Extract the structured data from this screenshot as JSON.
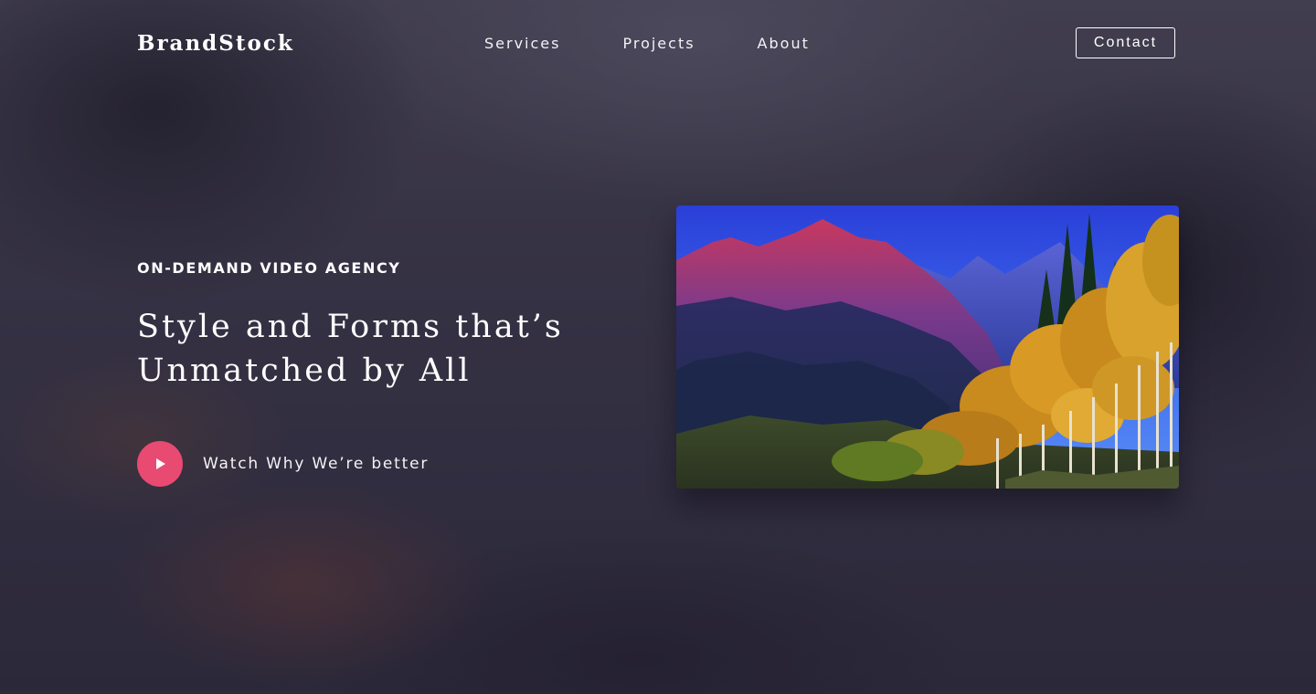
{
  "header": {
    "logo": "BrandStock",
    "nav": [
      {
        "label": "Services"
      },
      {
        "label": "Projects"
      },
      {
        "label": "About"
      }
    ],
    "contact_label": "Contact"
  },
  "hero": {
    "kicker": "ON-DEMAND VIDEO AGENCY",
    "headline_line1": "Style and Forms that’s",
    "headline_line2": "Unmatched by All",
    "watch_label": "Watch Why We’re better",
    "play_icon": "play-icon"
  },
  "colors": {
    "accent": "#e84a72",
    "background": "#3a3748",
    "text": "#ffffff"
  }
}
